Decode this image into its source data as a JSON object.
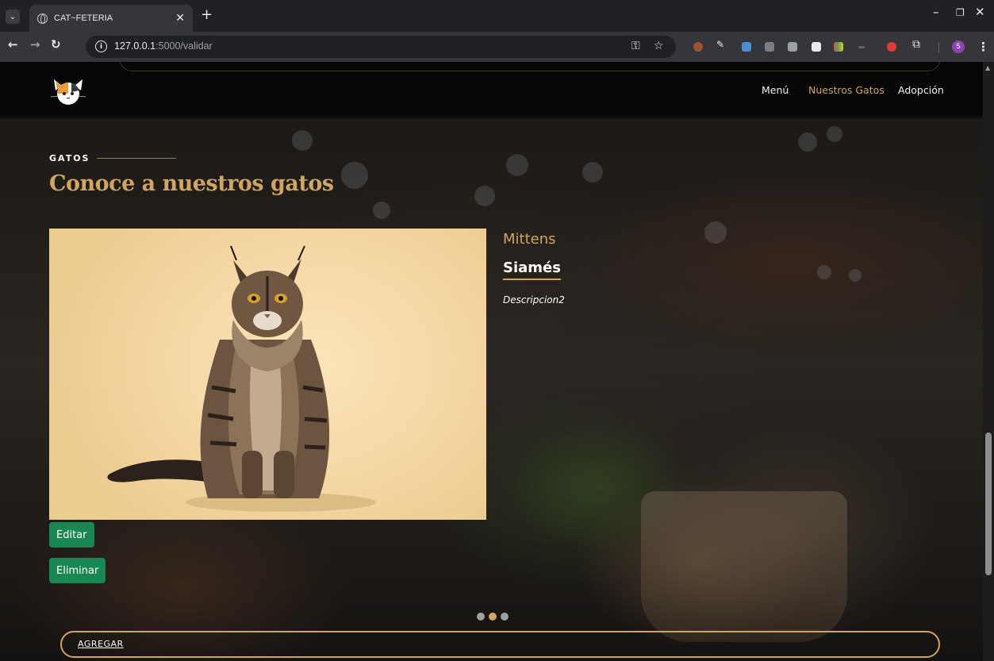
{
  "browser": {
    "tab_title": "CAT~FETERIA",
    "url_host": "127.0.0.1",
    "url_path": ":5000/validar",
    "profile_initial": "S"
  },
  "nav": {
    "items": [
      {
        "label": "Menú",
        "active": false
      },
      {
        "label": "Nuestros Gatos",
        "active": true
      },
      {
        "label": "Adopción",
        "active": false
      }
    ]
  },
  "section": {
    "kicker": "GATOS",
    "title": "Conoce a nuestros gatos"
  },
  "cat": {
    "name": "Mittens",
    "breed": "Siamés",
    "description": "Descripcion2"
  },
  "actions": {
    "edit_label": "Editar",
    "delete_label": "Eliminar",
    "add_label": "AGREGAR"
  },
  "carousel": {
    "total": 3,
    "active_index": 1
  },
  "colors": {
    "accent": "#cfa560",
    "button_green": "#198754"
  }
}
